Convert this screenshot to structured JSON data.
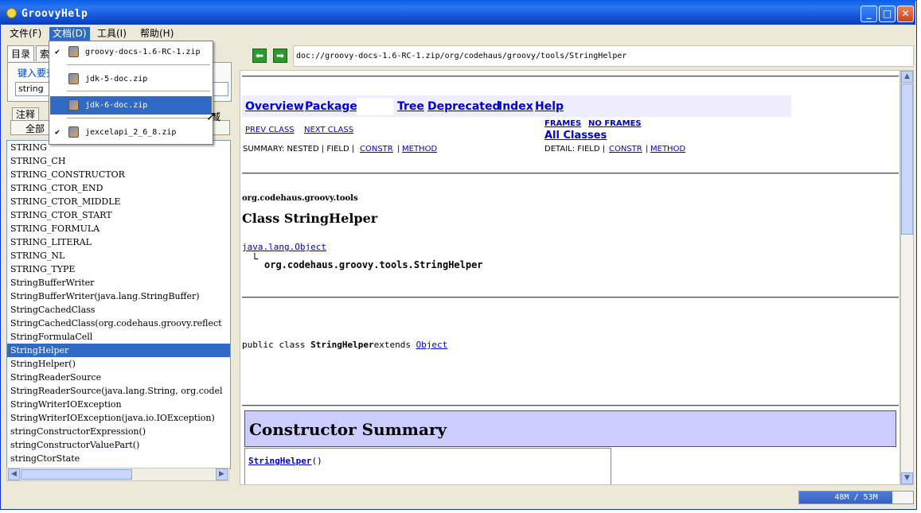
{
  "window": {
    "title": "GroovyHelp"
  },
  "menu": [
    {
      "label": "文件(F)"
    },
    {
      "label": "文档(D)"
    },
    {
      "label": "工具(I)"
    },
    {
      "label": "帮助(H)"
    }
  ],
  "dropdown": {
    "items": [
      {
        "label": "groovy-docs-1.6-RC-1.zip",
        "checked": true
      },
      {
        "label": "jdk-5-doc.zip",
        "checked": false
      },
      {
        "label": "jdk-6-doc.zip",
        "checked": false,
        "selected": true
      },
      {
        "label": "jexcelapi_2_6_8.zip",
        "checked": true
      }
    ]
  },
  "left": {
    "tabs": [
      "目录",
      "索"
    ],
    "search_label": "键入要查",
    "search_value": "string",
    "subtabs": [
      "注释",
      "全部"
    ],
    "area_tab": "域",
    "rows": [
      "STRING",
      "STRING_CH",
      "STRING_CONSTRUCTOR",
      "STRING_CTOR_END",
      "STRING_CTOR_MIDDLE",
      "STRING_CTOR_START",
      "STRING_FORMULA",
      "STRING_LITERAL",
      "STRING_NL",
      "STRING_TYPE",
      "StringBufferWriter",
      "StringBufferWriter(java.lang.StringBuffer)",
      "StringCachedClass",
      "StringCachedClass(org.codehaus.groovy.reflect",
      "StringFormulaCell",
      "StringHelper",
      "StringHelper()",
      "StringReaderSource",
      "StringReaderSource(java.lang.String, org.codel",
      "StringWriterIOException",
      "StringWriterIOException(java.io.IOException)",
      "stringConstructorExpression()",
      "stringConstructorValuePart()",
      "stringCtorState"
    ],
    "selected_row": "StringHelper"
  },
  "address": "doc://groovy-docs-1.6-RC-1.zip/org/codehaus/groovy/tools/StringHelper",
  "doc": {
    "nav": [
      "Overview",
      "Package",
      "Tree",
      "Deprecated",
      "Index",
      "Help"
    ],
    "prev_class": "PREV CLASS",
    "next_class": "NEXT CLASS",
    "frames": "FRAMES",
    "no_frames": "NO FRAMES",
    "all_classes": "All Classes",
    "summary_label": "SUMMARY: NESTED | FIELD |",
    "detail_label": "DETAIL: FIELD |",
    "constr": "CONSTR",
    "method": "METHOD",
    "sep": "|",
    "package": "org.codehaus.groovy.tools",
    "class_title": "Class StringHelper",
    "super": "java.lang.Object",
    "sub": "org.codehaus.groovy.tools.StringHelper",
    "decl_prefix": "public class ",
    "decl_name": "StringHelper",
    "decl_extends": "extends ",
    "decl_super": "Object",
    "constructor_summary": "Constructor Summary",
    "ctor_link": "StringHelper",
    "ctor_suffix": "()"
  },
  "status": {
    "memory": "48M / 53M",
    "memory_fraction": 0.82
  }
}
